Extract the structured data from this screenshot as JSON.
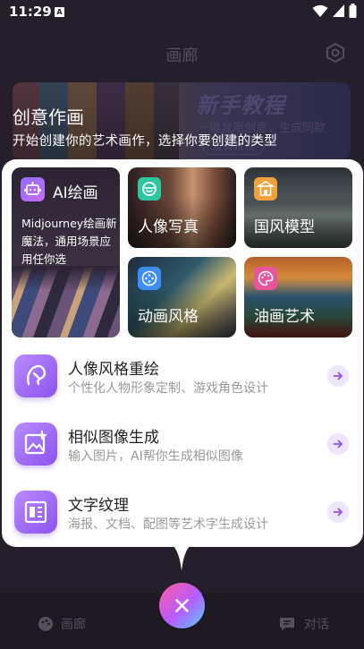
{
  "status_bar": {
    "time": "11:29",
    "notif_letter": "A"
  },
  "background": {
    "page_title": "画廊",
    "banner": {
      "promo_title": "新手教程",
      "promo_subtitle": "一键复用创意，生成同款",
      "promo_button": "查看教程"
    },
    "tabs": {
      "gallery": "画廊",
      "chat": "对话"
    }
  },
  "header": {
    "title": "创意作画",
    "subtitle": "开始创建你的艺术画作，选择你要创建的类型"
  },
  "grid": {
    "ai_card": {
      "title": "AI绘画",
      "description": "Midjourney绘画新魔法，通用场景应用任你选"
    },
    "cards": [
      {
        "title": "人像写真",
        "icon": "smile-icon",
        "icon_color": "#2fc7a0"
      },
      {
        "title": "国风模型",
        "icon": "pavilion-icon",
        "icon_color": "#f0a13a"
      },
      {
        "title": "动画风格",
        "icon": "gamepad-icon",
        "icon_color": "#3d8df5"
      },
      {
        "title": "油画艺术",
        "icon": "palette-icon",
        "icon_color": "#e9559c"
      }
    ]
  },
  "list": [
    {
      "title": "人像风格重绘",
      "description": "个性化人物形象定制、游戏角色设计",
      "icon": "portrait-brush-icon"
    },
    {
      "title": "相似图像生成",
      "description": "输入图片，AI帮你生成相似图像",
      "icon": "image-plus-icon"
    },
    {
      "title": "文字纹理",
      "description": "海报、文档、配图等艺术字生成设计",
      "icon": "text-layout-icon"
    }
  ],
  "colors": {
    "accent": "#8c52ee",
    "arrow_bg": "#efe5fd"
  }
}
